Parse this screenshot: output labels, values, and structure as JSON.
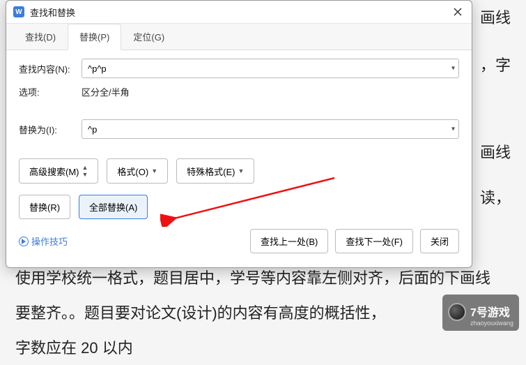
{
  "dialog": {
    "title": "查找和替换",
    "tabs": {
      "find": "查找(D)",
      "replace": "替换(P)",
      "goto": "定位(G)"
    },
    "find_label": "查找内容(N):",
    "find_value": "^p^p",
    "options_label": "选项:",
    "options_value": "区分全/半角",
    "replace_label": "替换为(I):",
    "replace_value": "^p",
    "buttons": {
      "advanced": "高级搜索(M)",
      "format": "格式(O)",
      "special": "特殊格式(E)",
      "replace": "替换(R)",
      "replace_all": "全部替换(A)",
      "find_prev": "查找上一处(B)",
      "find_next": "查找下一处(F)",
      "close": "关闭"
    },
    "tips": "操作技巧"
  },
  "background": {
    "l1": "画线",
    "l2": "，字",
    "l3": "画线",
    "l4": "读，",
    "l5": "使用学校统一格式，题目居中，学号等内容靠左侧对齐，后面的下画线",
    "l6": "要整齐。。题目要对论文(设计)的内容有高度的概括性，",
    "l7": "字数应在 20 以内"
  },
  "watermark": {
    "title": "7号游戏",
    "sub": "zhaoyouxiwang"
  },
  "colors": {
    "accent": "#3a7de0",
    "arrow": "#e11"
  }
}
